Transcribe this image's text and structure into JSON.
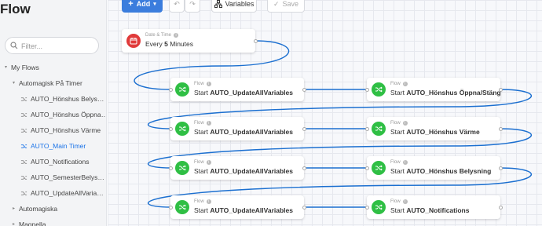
{
  "app": {
    "title": "Flow"
  },
  "search": {
    "placeholder": "Filter..."
  },
  "tree": [
    {
      "label": "My Flows",
      "caret": "▾"
    },
    {
      "label": "Automagisk På Timer",
      "caret": "▾"
    },
    {
      "label": "AUTO_Hönshus Belys…"
    },
    {
      "label": "AUTO_Hönshus Öppna…"
    },
    {
      "label": "AUTO_Hönshus Värme"
    },
    {
      "label": "AUTO_Main Timer"
    },
    {
      "label": "AUTO_Notifications"
    },
    {
      "label": "AUTO_SemesterBelys…"
    },
    {
      "label": "AUTO_UpdateAllVaria…"
    },
    {
      "label": "Automagiska",
      "caret": "▸"
    },
    {
      "label": "Magnella",
      "caret": "▸"
    }
  ],
  "toolbar": {
    "add_label": "Add",
    "variables_label": "Variables",
    "save_label": "Save",
    "icons": {
      "add": "plus-icon",
      "undo": "undo-icon",
      "redo": "redo-icon",
      "variables": "variables-icon",
      "save": "check-icon"
    }
  },
  "trigger": {
    "type": "Date & Time",
    "prefix": "Every",
    "value": "5",
    "suffix": "Minutes"
  },
  "cards": [
    {
      "type": "Flow",
      "prefix": "Start",
      "name": "AUTO_UpdateAllVariables"
    },
    {
      "type": "Flow",
      "prefix": "Start",
      "name": "AUTO_Hönshus Öppna/Stäng"
    },
    {
      "type": "Flow",
      "prefix": "Start",
      "name": "AUTO_UpdateAllVariables"
    },
    {
      "type": "Flow",
      "prefix": "Start",
      "name": "AUTO_Hönshus Värme"
    },
    {
      "type": "Flow",
      "prefix": "Start",
      "name": "AUTO_UpdateAllVariables"
    },
    {
      "type": "Flow",
      "prefix": "Start",
      "name": "AUTO_Hönshus Belysning"
    },
    {
      "type": "Flow",
      "prefix": "Start",
      "name": "AUTO_UpdateAllVariables"
    },
    {
      "type": "Flow",
      "prefix": "Start",
      "name": "AUTO_Notifications"
    }
  ],
  "colors": {
    "accent": "#3b7ddd",
    "active": "#1a73e8",
    "flow_icon": "#2fbf44",
    "trigger_icon": "#e03a3a",
    "wire": "#1b6fd0"
  }
}
